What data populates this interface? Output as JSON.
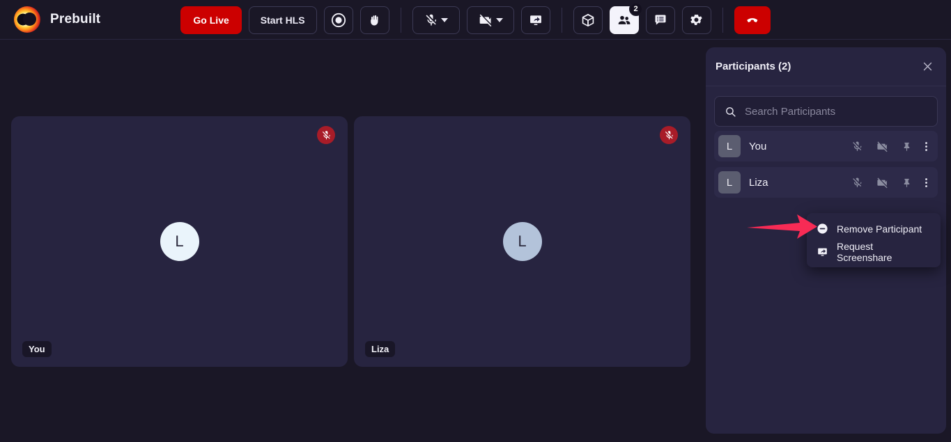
{
  "app": {
    "brand_name": "Prebuilt",
    "logo_icon": "eclipse-logo-icon",
    "accent_red": "#cc0000",
    "panel_bg": "#272440",
    "page_bg": "#1a1726"
  },
  "toolbar": {
    "go_live_label": "Go Live",
    "start_hls_label": "Start HLS",
    "record_icon": "record-circle-icon",
    "raise_hand_icon": "raise-hand-icon",
    "mic_icon": "mic-off-icon",
    "mic_caret_icon": "chevron-down-icon",
    "camera_icon": "camera-off-icon",
    "camera_caret_icon": "chevron-down-icon",
    "screenshare_icon": "screenshare-icon",
    "plugins_icon": "cube-icon",
    "participants_icon": "participants-icon",
    "participants_badge": "2",
    "chat_icon": "chat-icon",
    "settings_icon": "gear-icon",
    "end_call_icon": "end-call-icon"
  },
  "stage": {
    "tiles": [
      {
        "name": "You",
        "initial": "L",
        "avatar_color": "#eaf4fb",
        "muted": true,
        "mute_icon": "mic-off-icon"
      },
      {
        "name": "Liza",
        "initial": "L",
        "avatar_color": "#b3c3da",
        "muted": true,
        "mute_icon": "mic-off-icon"
      }
    ]
  },
  "panel": {
    "title": "Participants (2)",
    "close_icon": "close-icon",
    "search": {
      "icon": "search-icon",
      "placeholder": "Search Participants",
      "value": ""
    },
    "rows": [
      {
        "initial": "L",
        "name": "You",
        "mic_icon": "mic-off-icon",
        "camera_icon": "camera-off-icon",
        "pin_icon": "pin-icon",
        "more_icon": "more-vertical-icon"
      },
      {
        "initial": "L",
        "name": "Liza",
        "mic_icon": "mic-off-icon",
        "camera_icon": "camera-off-icon",
        "pin_icon": "pin-icon",
        "more_icon": "more-vertical-icon"
      }
    ]
  },
  "context_menu": {
    "items": [
      {
        "label": "Remove Participant",
        "icon": "minus-circle-icon"
      },
      {
        "label": "Request Screenshare",
        "icon": "screenshare-icon"
      }
    ]
  },
  "annotation": {
    "arrow_color": "#f72b55",
    "points_to": "Remove Participant"
  }
}
